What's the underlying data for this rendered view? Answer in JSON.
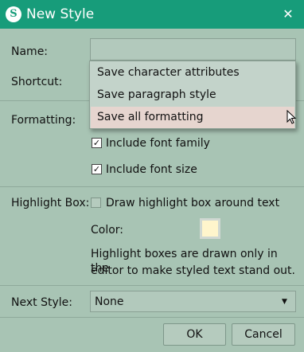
{
  "window": {
    "title": "New Style",
    "app_icon_glyph": "S"
  },
  "form": {
    "name_label": "Name:",
    "name_value": "",
    "shortcut_label": "Shortcut:",
    "formatting_label": "Formatting:",
    "include_font_family": {
      "label": "Include font family",
      "checked": true
    },
    "include_font_size": {
      "label": "Include font size",
      "checked": true
    },
    "highlight_box_label": "Highlight Box:",
    "draw_highlight": {
      "label": "Draw highlight box around text",
      "checked": false
    },
    "color_label": "Color:",
    "color_value": "#fff5cc",
    "highlight_info_line1": "Highlight boxes are drawn only in the",
    "highlight_info_line2": "editor to make styled text stand out.",
    "next_style_label": "Next Style:",
    "next_style_value": "None"
  },
  "formatting_menu": {
    "items": [
      "Save character attributes",
      "Save paragraph style",
      "Save all formatting"
    ],
    "highlighted_index": 2
  },
  "buttons": {
    "ok": "OK",
    "cancel": "Cancel"
  },
  "colors": {
    "titlebar": "#179c7a",
    "dialog_bg": "#a8c4b4",
    "menu_highlight": "#e6d5cf"
  },
  "icons": [
    "app-logo-icon",
    "close-icon",
    "checkmark-icon",
    "chevron-down-icon",
    "mouse-cursor-icon"
  ]
}
